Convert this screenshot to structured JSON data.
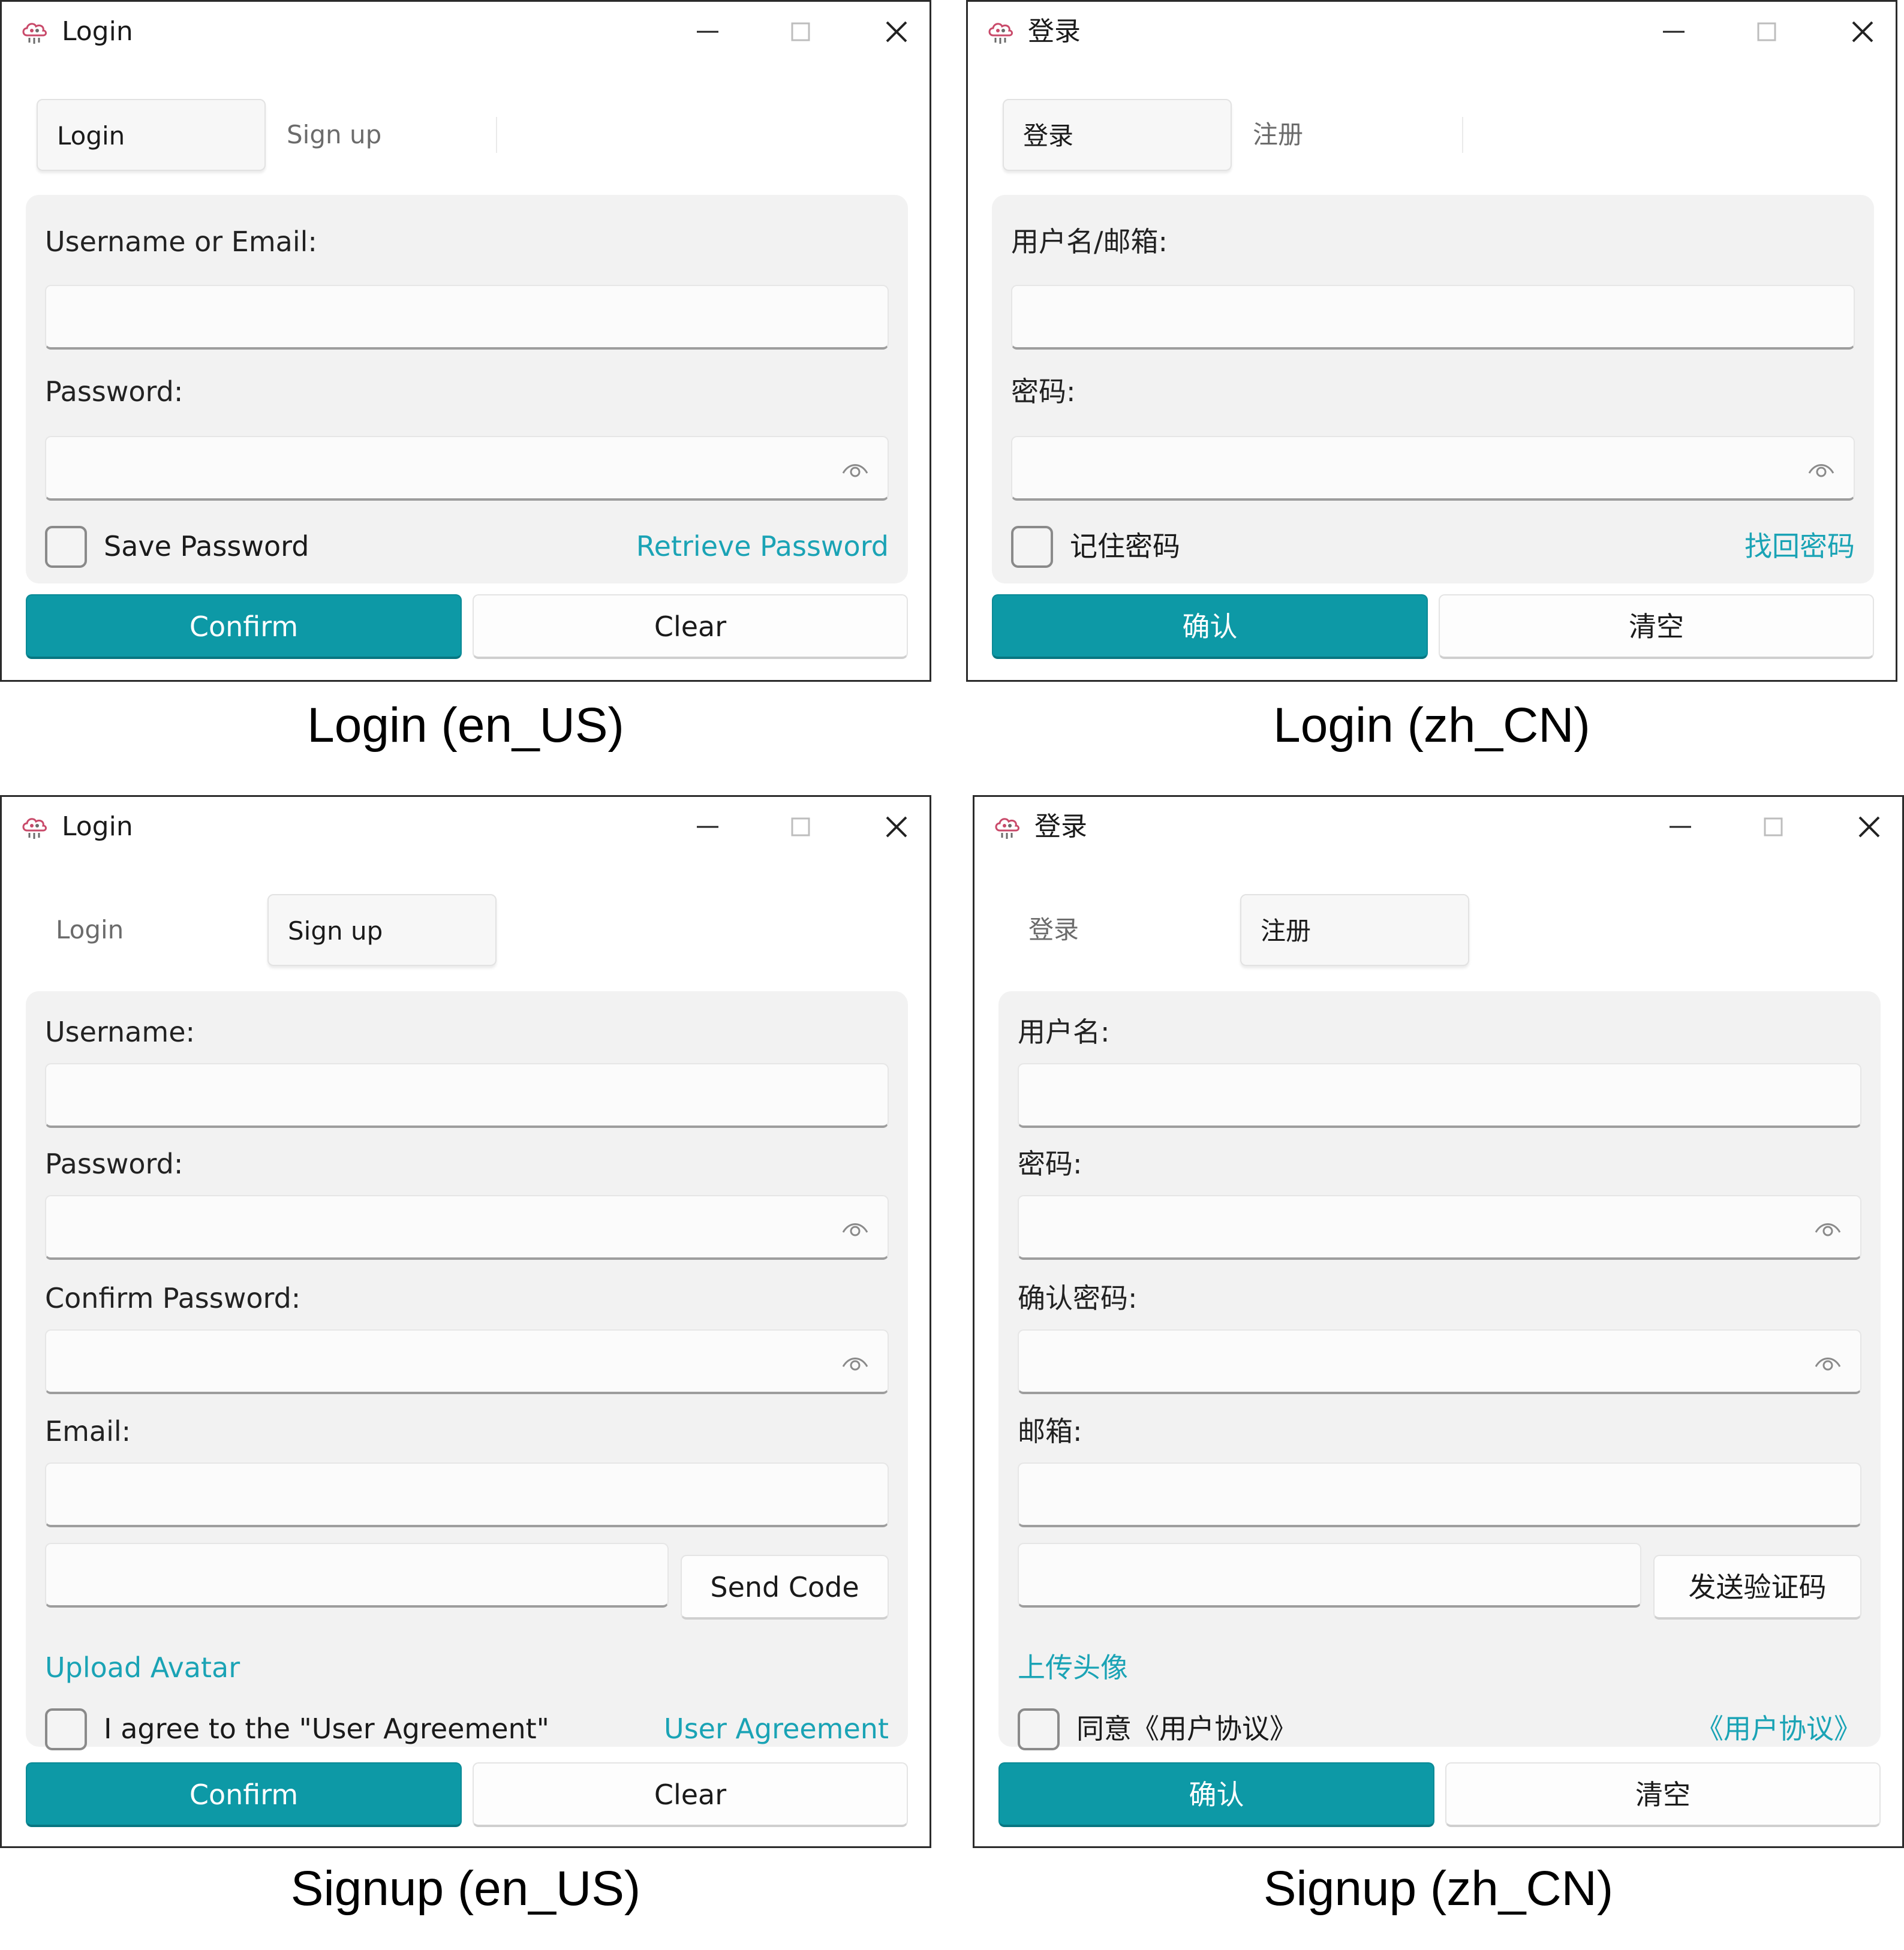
{
  "colors": {
    "accent": "#0d99a6",
    "link": "#1aa3b5",
    "card_bg": "#f2f2f2",
    "window_border": "#2b2b2b"
  },
  "icons": {
    "app": "cloud-app-icon",
    "minimize": "minimize-icon",
    "maximize": "maximize-icon",
    "close": "close-icon",
    "reveal": "eye-icon"
  },
  "captions": [
    "Login (en_US)",
    "Login (zh_CN)",
    "Signup (en_US)",
    "Signup (zh_CN)"
  ],
  "windows": {
    "login_en": {
      "title": "Login",
      "tabs": [
        "Login",
        "Sign up"
      ],
      "active_tab": "Login",
      "username_label": "Username or Email:",
      "password_label": "Password:",
      "username_value": "",
      "password_value": "",
      "save_password": "Save Password",
      "save_password_checked": false,
      "retrieve_password": "Retrieve Password",
      "confirm": "Confirm",
      "clear": "Clear"
    },
    "login_zh": {
      "title": "登录",
      "tabs": [
        "登录",
        "注册"
      ],
      "active_tab": "登录",
      "username_label": "用户名/邮箱:",
      "password_label": "密码:",
      "username_value": "",
      "password_value": "",
      "save_password": "记住密码",
      "save_password_checked": false,
      "retrieve_password": "找回密码",
      "confirm": "确认",
      "clear": "清空"
    },
    "signup_en": {
      "title": "Login",
      "tabs": [
        "Login",
        "Sign up"
      ],
      "active_tab": "Sign up",
      "username_label": "Username:",
      "password_label": "Password:",
      "confirm_password_label": "Confirm Password:",
      "email_label": "Email:",
      "send_code": "Send Code",
      "upload_avatar": "Upload Avatar",
      "agree": "I agree to the \"User Agreement\"",
      "agree_checked": false,
      "user_agreement": "User Agreement",
      "confirm": "Confirm",
      "clear": "Clear"
    },
    "signup_zh": {
      "title": "登录",
      "tabs": [
        "登录",
        "注册"
      ],
      "active_tab": "注册",
      "username_label": "用户名:",
      "password_label": "密码:",
      "confirm_password_label": "确认密码:",
      "email_label": "邮箱:",
      "send_code": "发送验证码",
      "upload_avatar": "上传头像",
      "agree": "同意《用户协议》",
      "agree_checked": false,
      "user_agreement": "《用户协议》",
      "confirm": "确认",
      "clear": "清空"
    }
  }
}
